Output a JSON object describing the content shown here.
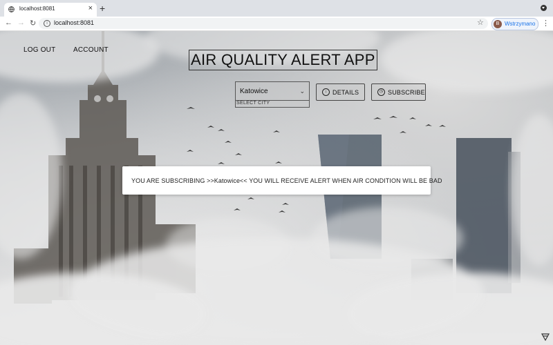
{
  "browser": {
    "tab_title": "localhost:8081",
    "url": "localhost:8081",
    "profile_initial": "B",
    "profile_name": "Wstrzymano"
  },
  "nav": {
    "logout": "LOG OUT",
    "account": "ACCOUNT"
  },
  "app": {
    "title": "AIR QUALITY ALERT APP"
  },
  "city_select": {
    "value": "Katowice",
    "label": "SELECT CITY"
  },
  "buttons": {
    "details": "DETAILS",
    "subscribe": "SUBSCRIBE"
  },
  "alert": {
    "message": "YOU ARE SUBSCRIBING >>Katowice<< YOU WILL RECEIVE ALERT WHEN AIR CONDITION WILL BE BAD"
  },
  "colors": {
    "profile_accent": "#1a73e8",
    "background_haze": "#c9cbcd"
  }
}
